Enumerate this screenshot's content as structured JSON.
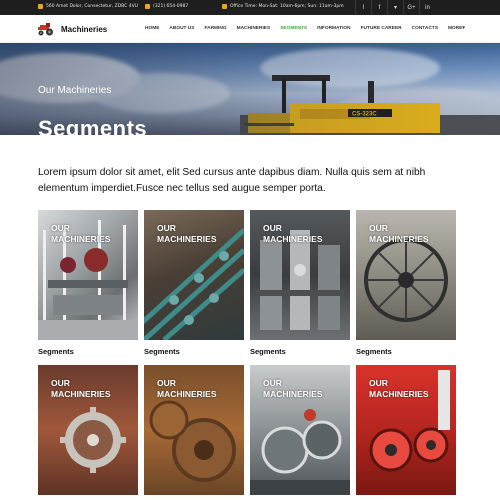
{
  "topbar": {
    "address": "560 Amet Dolor, Consectetur, ZDBC 4VU",
    "phone": "(321) 654-0987",
    "hours": "Office Time: Mon-Sat: 10am-6pm; Sun: 11am-3pm",
    "social": [
      "rss-icon",
      "facebook-icon",
      "twitter-icon",
      "google-plus-icon",
      "linkedin-icon"
    ],
    "social_glyphs": [
      "⌇",
      "f",
      "▾",
      "G+",
      "in"
    ]
  },
  "header": {
    "brand": "Machineries",
    "nav": [
      "HOME",
      "ABOUT US",
      "FARMING",
      "MACHINERIES",
      "SEGMENTS",
      "INFORMATION",
      "FUTURE CAREER",
      "CONTACTS",
      "MORE▾"
    ],
    "active_nav": "SEGMENTS"
  },
  "banner": {
    "subtitle": "Our Machineries",
    "title": "Segments"
  },
  "intro": "Lorem ipsum dolor sit amet, elit Sed cursus ante dapibus diam. Nulla quis sem at nibh elementum imperdiet.Fusce nec tellus sed augue semper porta.",
  "cards": [
    {
      "tag1": "OUR",
      "tag2": "MACHINERIES",
      "caption": "Segments"
    },
    {
      "tag1": "OUR",
      "tag2": "MACHINERIES",
      "caption": "Segments"
    },
    {
      "tag1": "OUR",
      "tag2": "MACHINERIES",
      "caption": "Segments"
    },
    {
      "tag1": "OUR",
      "tag2": "MACHINERIES",
      "caption": "Segments"
    },
    {
      "tag1": "OUR",
      "tag2": "MACHINERIES",
      "caption": ""
    },
    {
      "tag1": "OUR",
      "tag2": "MACHINERIES",
      "caption": ""
    },
    {
      "tag1": "OUR",
      "tag2": "MACHINERIES",
      "caption": ""
    },
    {
      "tag1": "OUR",
      "tag2": "MACHINERIES",
      "caption": ""
    }
  ],
  "colors": {
    "accent": "#44a53c",
    "topbar": "#1e1e1e",
    "icon": "#e6a81e"
  }
}
